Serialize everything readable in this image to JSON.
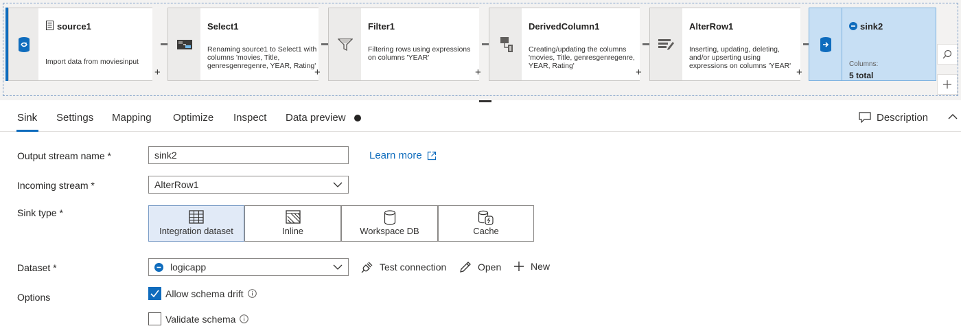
{
  "pipeline": {
    "nodes": [
      {
        "title": "source1",
        "desc": "Import data from moviesinput"
      },
      {
        "title": "Select1",
        "desc": "Renaming source1 to Select1 with columns 'movies, Title, genresgenregenre, YEAR, Rating'"
      },
      {
        "title": "Filter1",
        "desc": "Filtering rows using expressions on columns 'YEAR'"
      },
      {
        "title": "DerivedColumn1",
        "desc": "Creating/updating the columns 'movies, Title, genresgenregenre, YEAR, Rating'"
      },
      {
        "title": "AlterRow1",
        "desc": "Inserting, updating, deleting, and/or upserting using expressions on columns 'YEAR'"
      }
    ],
    "plus_label": "+",
    "sink": {
      "title": "sink2",
      "columns_label": "Columns:",
      "columns_value": "5 total"
    }
  },
  "tabs": [
    {
      "label": "Sink"
    },
    {
      "label": "Settings"
    },
    {
      "label": "Mapping"
    },
    {
      "label": "Optimize"
    },
    {
      "label": "Inspect"
    },
    {
      "label": "Data preview"
    }
  ],
  "description_label": "Description",
  "form": {
    "output_stream": {
      "label": "Output stream name *",
      "value": "sink2"
    },
    "learn_more": "Learn more",
    "incoming_stream": {
      "label": "Incoming stream *",
      "value": "AlterRow1"
    },
    "sink_type": {
      "label": "Sink type *",
      "options": [
        "Integration dataset",
        "Inline",
        "Workspace DB",
        "Cache"
      ],
      "selected": "Integration dataset"
    },
    "dataset": {
      "label": "Dataset *",
      "value": "logicapp"
    },
    "actions": {
      "test_connection": "Test connection",
      "open": "Open",
      "new": "New"
    },
    "options": {
      "label": "Options",
      "allow_schema_drift": "Allow schema drift",
      "allow_schema_drift_checked": true,
      "validate_schema": "Validate schema",
      "validate_schema_checked": false
    }
  },
  "colors": {
    "accent": "#0f6cbd",
    "sink_node": "#c7dff4",
    "selected_option": "#e1eaf7"
  }
}
